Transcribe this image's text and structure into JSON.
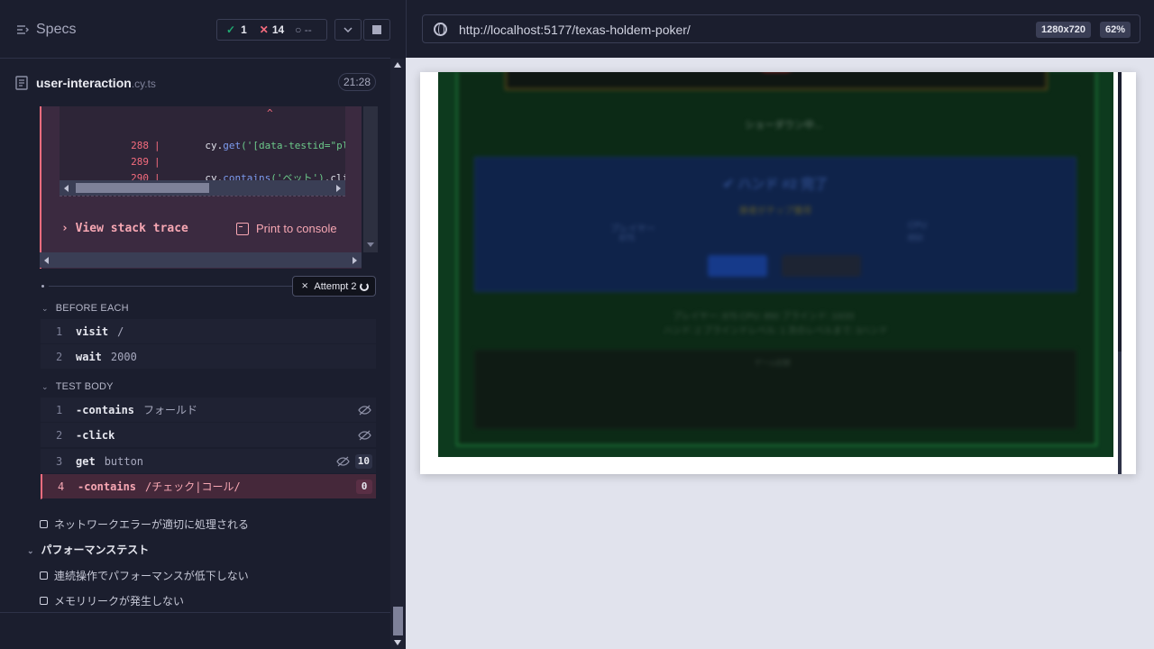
{
  "header": {
    "specs_label": "Specs",
    "passed": "1",
    "failed": "14",
    "pending": "--"
  },
  "spec_file": {
    "name": "user-interaction",
    "ext": ".cy.ts",
    "duration": "21:28"
  },
  "error": {
    "caret": "^",
    "code_lines": [
      {
        "num": "288",
        "fn": "get",
        "pre": "cy.",
        "args": "('[data-testid=\"player-",
        "tail": ""
      },
      {
        "num": "289",
        "fn": "",
        "pre": "",
        "args": "",
        "tail": ""
      },
      {
        "num": "290",
        "fn": "contains",
        "pre": "cy.",
        "args": "('ベット')",
        "tail": ".click({"
      }
    ],
    "stack_label": "View stack trace",
    "print_label": "Print to console"
  },
  "attempt": {
    "label": "Attempt 2"
  },
  "before_each": {
    "title": "BEFORE EACH",
    "commands": [
      {
        "num": "1",
        "name": "visit",
        "arg": "/"
      },
      {
        "num": "2",
        "name": "wait",
        "arg": "2000"
      }
    ]
  },
  "test_body": {
    "title": "TEST BODY",
    "commands": [
      {
        "num": "1",
        "name": "-contains",
        "arg": "フォールド"
      },
      {
        "num": "2",
        "name": "-click",
        "arg": ""
      },
      {
        "num": "3",
        "name": "get",
        "arg": "button",
        "count": "10"
      },
      {
        "num": "4",
        "name": "-contains",
        "arg": "/チェック|コール/",
        "count": "0"
      }
    ]
  },
  "tests": {
    "network_error": "ネットワークエラーが適切に処理される",
    "suite_title": "パフォーマンステスト",
    "perf_1": "連続操作でパフォーマンスが低下しない",
    "perf_2": "メモリリークが発生しない"
  },
  "aut": {
    "url": "http://localhost:5177/texas-holdem-poker/",
    "viewport": "1280x720",
    "zoom": "62%",
    "blurred": {
      "showdown": "ショーダウン中...",
      "hand_title": "✔ ハンド #2 完了",
      "hand_sub": "勝者がチップ獲得",
      "player": "プレイヤー",
      "player_val": "875",
      "cpu": "CPU",
      "cpu_val": "850",
      "info_1": "プレイヤー: 875    CPU: 850    ブラインド: 10/20",
      "info_2": "ハンド: 2    ブラインドレベル: 1    次のレベルまで: 3ハンド",
      "log_title": "ゲーム記録"
    }
  },
  "colors": {
    "pass": "#1fa971",
    "fail": "#f56c7e",
    "background": "#1b1e2e"
  }
}
